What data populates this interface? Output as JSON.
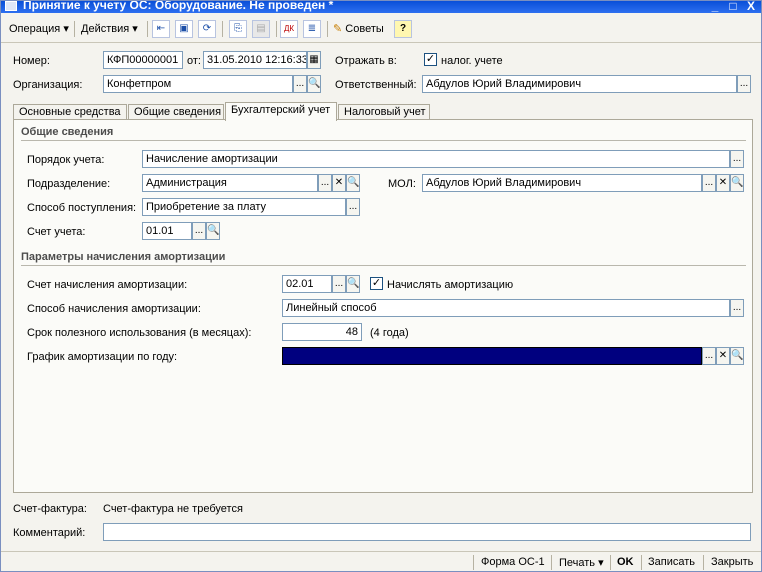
{
  "window": {
    "title": "Принятие к учету ОС: Оборудование. Не проведен *",
    "controls": [
      "_",
      "□",
      "X"
    ]
  },
  "toolbar": {
    "operation": "Операция ▾",
    "actions": "Действия ▾",
    "advice": "Советы",
    "help": "?"
  },
  "header": {
    "number_label": "Номер:",
    "number_value": "КФП00000001",
    "date_label": "от:",
    "date_value": "31.05.2010 12:16:33",
    "reflect_label": "Отражать в:",
    "tax_check": "✓",
    "tax_label": "налог. учете",
    "org_label": "Организация:",
    "org_value": "Конфетпром",
    "resp_label": "Ответственный:",
    "resp_value": "Абдулов Юрий Владимирович"
  },
  "tabs": [
    {
      "label": "Основные средства"
    },
    {
      "label": "Общие сведения"
    },
    {
      "label": "Бухгалтерский учет"
    },
    {
      "label": "Налоговый учет"
    }
  ],
  "general": {
    "title": "Общие сведения",
    "order_label": "Порядок учета:",
    "order_value": "Начисление амортизации",
    "dept_label": "Подразделение:",
    "dept_value": "Администрация",
    "mol_label": "МОЛ:",
    "mol_value": "Абдулов Юрий Владимирович",
    "method_label": "Способ поступления:",
    "method_value": "Приобретение за плату",
    "account_label": "Счет учета:",
    "account_value": "01.01"
  },
  "depreciation": {
    "title": "Параметры начисления амортизации",
    "account_label": "Счет начисления амортизации:",
    "account_value": "02.01",
    "charge_check": "✓",
    "charge_label": "Начислять амортизацию",
    "method_label": "Способ начисления амортизации:",
    "method_value": "Линейный способ",
    "term_label": "Срок полезного использования (в месяцах):",
    "term_value": "48",
    "term_note": "(4 года)",
    "schedule_label": "График амортизации по году:",
    "schedule_value": ""
  },
  "footer": {
    "invoice_label": "Счет-фактура:",
    "invoice_value": "Счет-фактура не требуется",
    "comment_label": "Комментарий:",
    "comment_value": ""
  },
  "status": {
    "form": "Форма ОС-1",
    "print": "Печать ▾",
    "ok": "OK",
    "save": "Записать",
    "close": "Закрыть"
  },
  "colors": {
    "selected_field": "#00007f",
    "titlebar": "#0a4fd8"
  }
}
